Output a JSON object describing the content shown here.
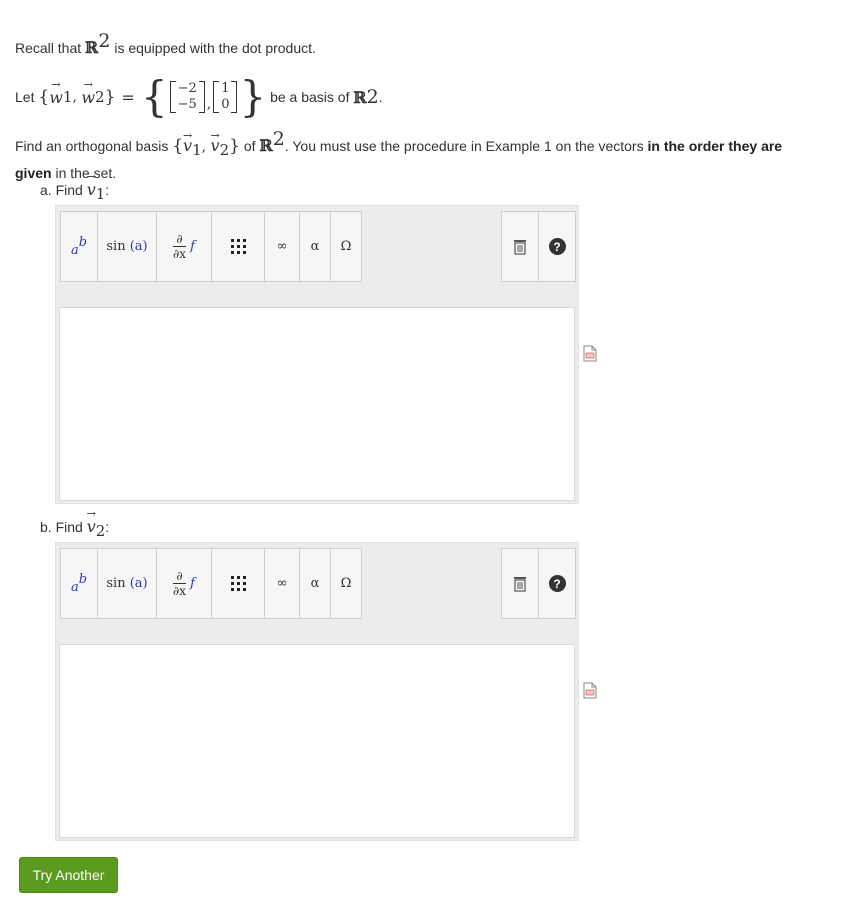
{
  "intro": {
    "recall_pre": "Recall that",
    "bbR": "ℝ",
    "exp": "2",
    "recall_post": "is equipped with the dot product."
  },
  "basis": {
    "let": "Let",
    "w": "w",
    "sub1": "1",
    "sub2": "2",
    "equals": "=",
    "vec1": [
      "−2",
      "−5"
    ],
    "vec2": [
      "1",
      "0"
    ],
    "post": "be a basis of",
    "bbR": "ℝ",
    "exp": "2",
    "period": "."
  },
  "task": {
    "find_pre": "Find an orthogonal basis",
    "v": "v",
    "sub1": "1",
    "sub2": "2",
    "of": "of",
    "bbR": "ℝ",
    "exp": "2",
    "instruction": ". You must use the procedure in Example 1 on the vectors",
    "bold1": "in the order they are",
    "bold2": "given",
    "tail": "in the set."
  },
  "part_a": {
    "label": "a. Find",
    "v": "v",
    "sub": "1",
    "colon": ":"
  },
  "part_b": {
    "label": "b. Find",
    "v": "v",
    "sub": "2",
    "colon": ":"
  },
  "toolbar": {
    "power_base": "a",
    "power_exp": "b",
    "sin_label": "sin",
    "sin_arg": "(a)",
    "deriv_num": "∂",
    "deriv_den": "∂x",
    "deriv_f": "f",
    "infinity": "∞",
    "alpha": "α",
    "omega": "Ω",
    "help": "?"
  },
  "actions": {
    "try_another": "Try Another"
  },
  "colors": {
    "button_green": "#5a9a1e",
    "math_blue": "#2c3bb0"
  }
}
